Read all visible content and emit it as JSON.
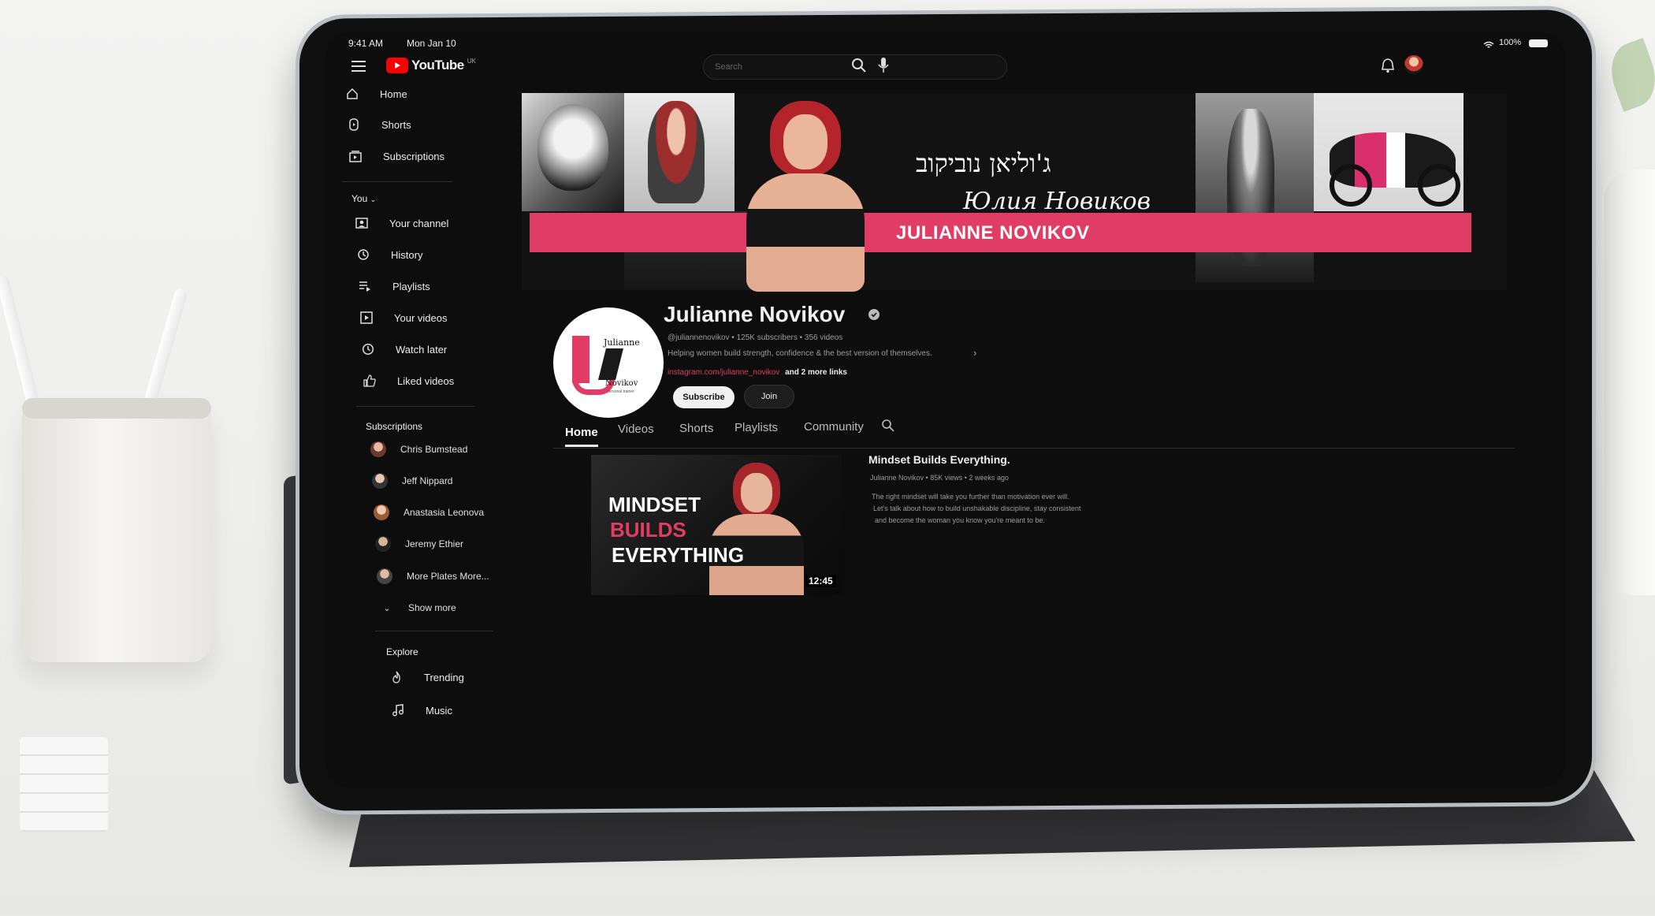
{
  "status_bar": {
    "time": "9:41 AM",
    "date": "Mon Jan 10",
    "battery": "100%"
  },
  "topbar": {
    "logo_text": "YouTube",
    "logo_region": "UK",
    "search_placeholder": "Search"
  },
  "sidebar": {
    "main": [
      {
        "label": "Home",
        "icon": "home-icon"
      },
      {
        "label": "Shorts",
        "icon": "shorts-icon"
      },
      {
        "label": "Subscriptions",
        "icon": "subscriptions-icon"
      }
    ],
    "you_header": "You",
    "you": [
      {
        "label": "Your channel",
        "icon": "channel-icon"
      },
      {
        "label": "History",
        "icon": "history-icon"
      },
      {
        "label": "Playlists",
        "icon": "playlists-icon"
      },
      {
        "label": "Your videos",
        "icon": "videos-icon"
      },
      {
        "label": "Watch later",
        "icon": "clock-icon"
      },
      {
        "label": "Liked videos",
        "icon": "thumbs-up-icon"
      }
    ],
    "subs_header": "Subscriptions",
    "subscriptions": [
      "Chris Bumstead",
      "Jeff Nippard",
      "Anastasia Leonova",
      "Jeremy Ethier",
      "More Plates More..."
    ],
    "show_more": "Show more",
    "explore_header": "Explore",
    "explore": [
      {
        "label": "Trending",
        "icon": "trending-icon"
      },
      {
        "label": "Music",
        "icon": "music-icon"
      }
    ]
  },
  "banner": {
    "hebrew": "ג'וליאן נוביקוב",
    "russian": "Юлия Новиков",
    "name_caps": "JULIANNE NOVIKOV",
    "accent": "#e13c66"
  },
  "channel": {
    "name": "Julianne Novikov",
    "meta": "@juliannenovikov • 125K subscribers • 356 videos",
    "description": "Helping women build strength, confidence & the best version of themselves.",
    "link": "instagram.com/julianne_novikov",
    "more_links": "and 2 more links",
    "subscribe_label": "Subscribe",
    "join_label": "Join",
    "logo": {
      "top": "Julianne",
      "bottom": "Novikov",
      "tag": "personal trainer"
    }
  },
  "tabs": [
    "Home",
    "Videos",
    "Shorts",
    "Playlists",
    "Community"
  ],
  "featured": {
    "thumb_lines": [
      "MINDSET",
      "BUILDS",
      "EVERYTHING"
    ],
    "duration": "12:45",
    "title": "Mindset Builds Everything.",
    "meta": "Julianne Novikov • 85K views • 2 weeks ago",
    "desc1": "The right mindset will take you further than motivation ever will.",
    "desc2": "Let's talk about how to build unshakable discipline, stay consistent",
    "desc3": "and become the woman you know you're meant to be."
  }
}
